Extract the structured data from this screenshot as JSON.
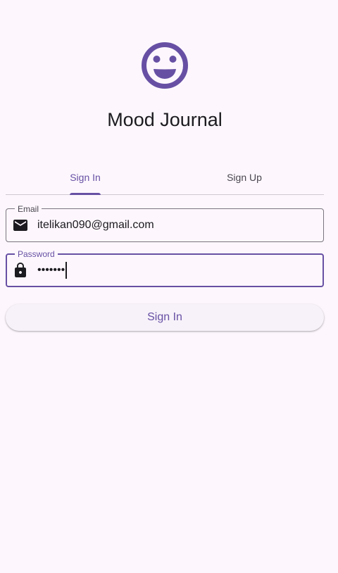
{
  "app": {
    "title": "Mood Journal",
    "logo_icon": "smiley-face-icon"
  },
  "tabs": [
    {
      "label": "Sign In",
      "active": true
    },
    {
      "label": "Sign Up",
      "active": false
    }
  ],
  "form": {
    "email": {
      "label": "Email",
      "value": "itelikan090@gmail.com",
      "icon": "mail-icon"
    },
    "password": {
      "label": "Password",
      "value": "•••••••",
      "icon": "lock-icon",
      "focused": true
    },
    "submit_label": "Sign In"
  },
  "colors": {
    "accent": "#6750A4",
    "background": "#FDF7FD",
    "text": "#1C1B1F"
  }
}
